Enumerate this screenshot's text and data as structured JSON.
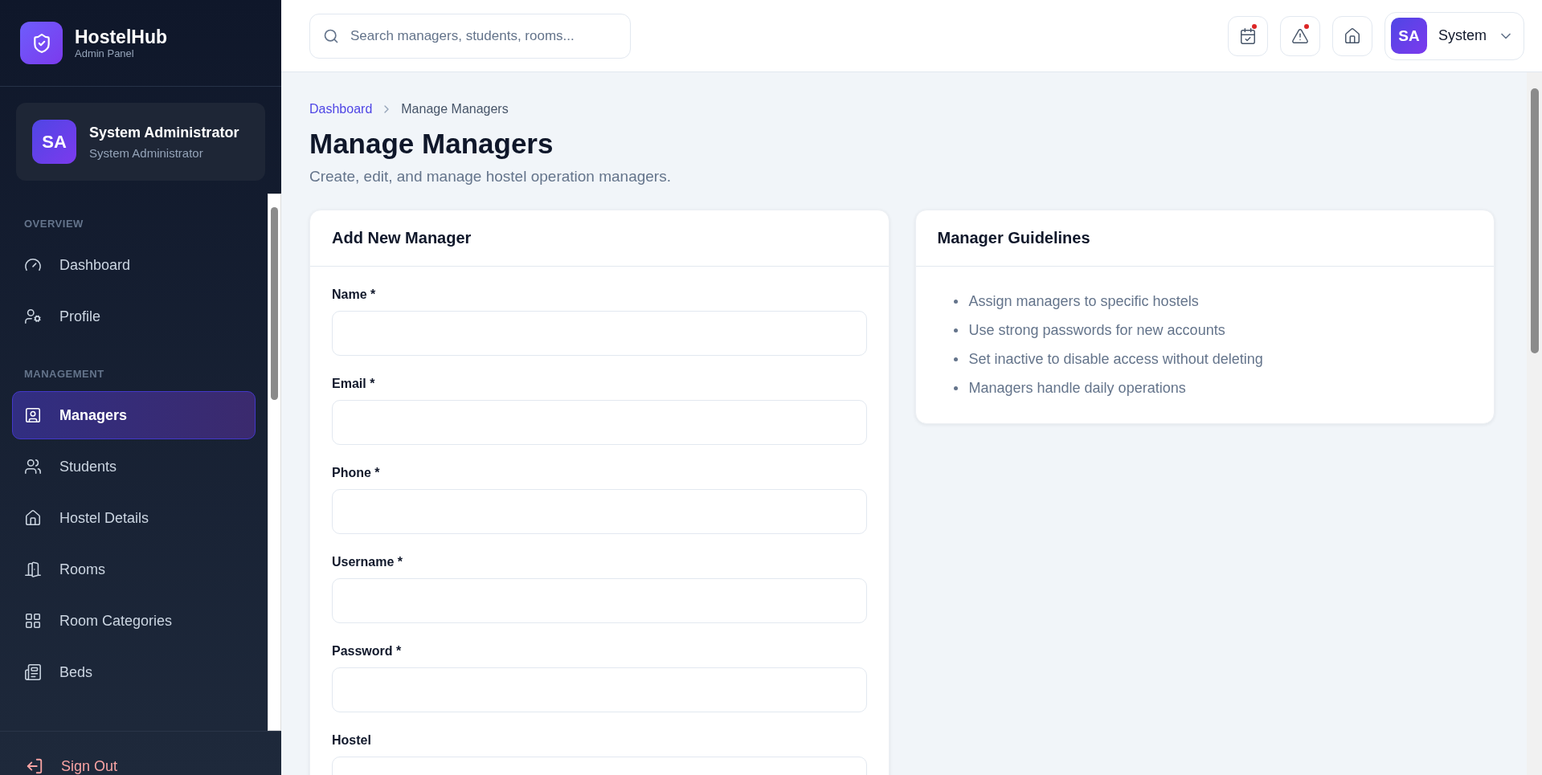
{
  "brand": {
    "name": "HostelHub",
    "subtitle": "Admin Panel"
  },
  "user_card": {
    "initials": "SA",
    "name": "System Administrator",
    "role": "System Administrator"
  },
  "sidebar": {
    "sections": [
      {
        "title": "OVERVIEW",
        "items": [
          {
            "label": "Dashboard",
            "kind": "dashboard",
            "selected": false
          },
          {
            "label": "Profile",
            "kind": "profile",
            "selected": false
          }
        ]
      },
      {
        "title": "MANAGEMENT",
        "items": [
          {
            "label": "Managers",
            "kind": "managers",
            "selected": true
          },
          {
            "label": "Students",
            "kind": "students",
            "selected": false
          },
          {
            "label": "Hostel Details",
            "kind": "hostel",
            "selected": false
          },
          {
            "label": "Rooms",
            "kind": "rooms",
            "selected": false
          },
          {
            "label": "Room Categories",
            "kind": "categories",
            "selected": false
          },
          {
            "label": "Beds",
            "kind": "beds",
            "selected": false
          }
        ]
      }
    ],
    "sign_out": "Sign Out"
  },
  "header": {
    "search": {
      "placeholder": "Search managers, students, rooms..."
    },
    "buttons": [
      {
        "kind": "calendar",
        "badge": true
      },
      {
        "kind": "alert",
        "badge": true
      },
      {
        "kind": "home",
        "badge": false
      }
    ],
    "user": {
      "initials": "SA",
      "name": "System"
    }
  },
  "breadcrumb": [
    {
      "label": "Dashboard",
      "selected": false
    },
    {
      "label": "Manage Managers",
      "selected": true
    }
  ],
  "page": {
    "title": "Manage Managers",
    "subtitle": "Create, edit, and manage hostel operation managers."
  },
  "form": {
    "title": "Add New Manager",
    "fields": [
      {
        "label": "Name *"
      },
      {
        "label": "Email *"
      },
      {
        "label": "Phone *"
      },
      {
        "label": "Username *"
      },
      {
        "label": "Password *"
      },
      {
        "label": "Hostel"
      }
    ]
  },
  "guidelines": {
    "title": "Manager Guidelines",
    "items": [
      "Assign managers to specific hostels",
      "Use strong passwords for new accounts",
      "Set inactive to disable access without deleting",
      "Managers handle daily operations"
    ]
  }
}
